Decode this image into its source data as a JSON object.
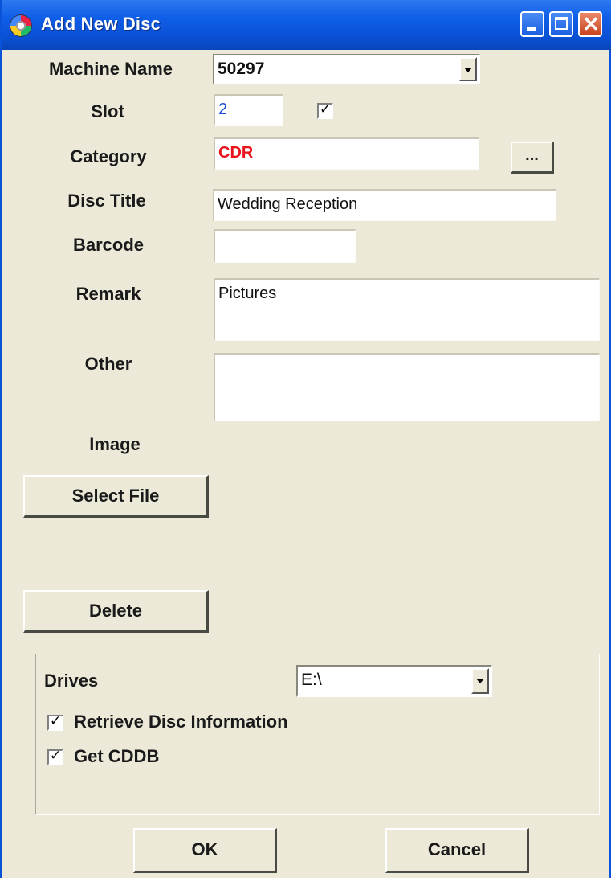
{
  "window": {
    "title": "Add New Disc",
    "icon": "disc-icon"
  },
  "title_buttons": {
    "minimize": "minimize-icon",
    "maximize": "maximize-icon",
    "close": "close-icon"
  },
  "fields": {
    "machine_name": {
      "label": "Machine Name",
      "value": "50297"
    },
    "slot": {
      "label": "Slot",
      "value": "2",
      "checked": true,
      "value_color": "#1f4fd6"
    },
    "category": {
      "label": "Category",
      "value": "CDR",
      "browse_label": "...",
      "value_color": "#e8131b"
    },
    "disc_title": {
      "label": "Disc Title",
      "value": "Wedding Reception"
    },
    "barcode": {
      "label": "Barcode",
      "value": ""
    },
    "remark": {
      "label": "Remark",
      "value": "Pictures"
    },
    "other": {
      "label": "Other",
      "value": ""
    },
    "image": {
      "label": "Image"
    }
  },
  "buttons": {
    "select_file": "Select File",
    "delete": "Delete",
    "ok": "OK",
    "cancel": "Cancel"
  },
  "drives": {
    "label": "Drives",
    "value": "E:\\",
    "retrieve_info": {
      "label": "Retrieve Disc Information",
      "checked": true
    },
    "get_cddb": {
      "label": "Get CDDB",
      "checked": true
    }
  }
}
